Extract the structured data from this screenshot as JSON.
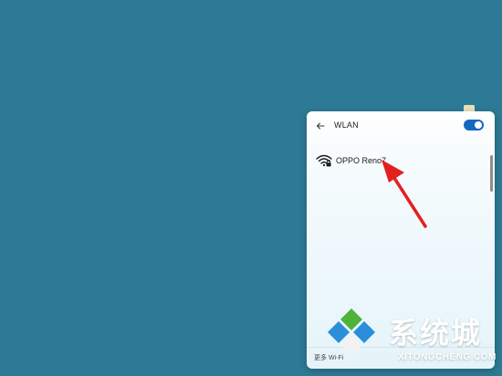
{
  "wlan_panel": {
    "back_icon": "back-arrow-icon",
    "title": "WLAN",
    "toggle": {
      "state": "on",
      "color": "#1567c0"
    },
    "networks": [
      {
        "name": "OPPO Reno7",
        "icon": "wifi-secured-icon"
      }
    ],
    "footer_link": "更多 Wi-Fi"
  },
  "annotation": {
    "arrow_color": "#e32020"
  },
  "watermark": {
    "brand": "系统城",
    "site": "XITONGCHENG.COM",
    "logo_colors": [
      "#4fb23a",
      "#2a8fd8",
      "#f2f2f2"
    ]
  },
  "colors": {
    "desktop": "#2d7a96",
    "panel": "#e5f4fa"
  }
}
